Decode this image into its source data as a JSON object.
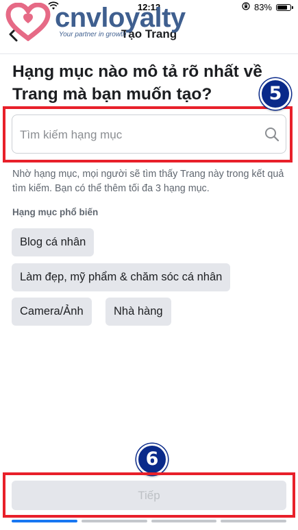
{
  "status_bar": {
    "time": "12:12",
    "battery_text": "83%",
    "battery_level": 0.83
  },
  "logo": {
    "name": "cnvloyalty",
    "tagline": "Your partner in growth"
  },
  "header": {
    "title": "Tạo Trang",
    "back_icon": "chevron-left-icon"
  },
  "main": {
    "headline": "Hạng mục nào mô tả rõ nhất về Trang mà bạn muốn tạo?",
    "search": {
      "placeholder": "Tìm kiếm hạng mục",
      "value": "",
      "icon": "search-icon"
    },
    "helper_text": "Nhờ hạng mục, mọi người sẽ tìm thấy Trang này trong kết quả tìm kiếm. Bạn có thể thêm tối đa 3 hạng mục.",
    "popular_label": "Hạng mục phổ biến",
    "categories": [
      "Blog cá nhân",
      "Làm đẹp, mỹ phẩm & chăm sóc cá nhân",
      "Camera/Ảnh",
      "Nhà hàng"
    ]
  },
  "annotations": {
    "step_search": "5",
    "step_next": "6",
    "highlight_color": "#e8202a",
    "badge_color": "#0a2a8a"
  },
  "footer": {
    "next_label": "Tiếp",
    "progress_steps_total": 4,
    "progress_step_current": 1
  }
}
